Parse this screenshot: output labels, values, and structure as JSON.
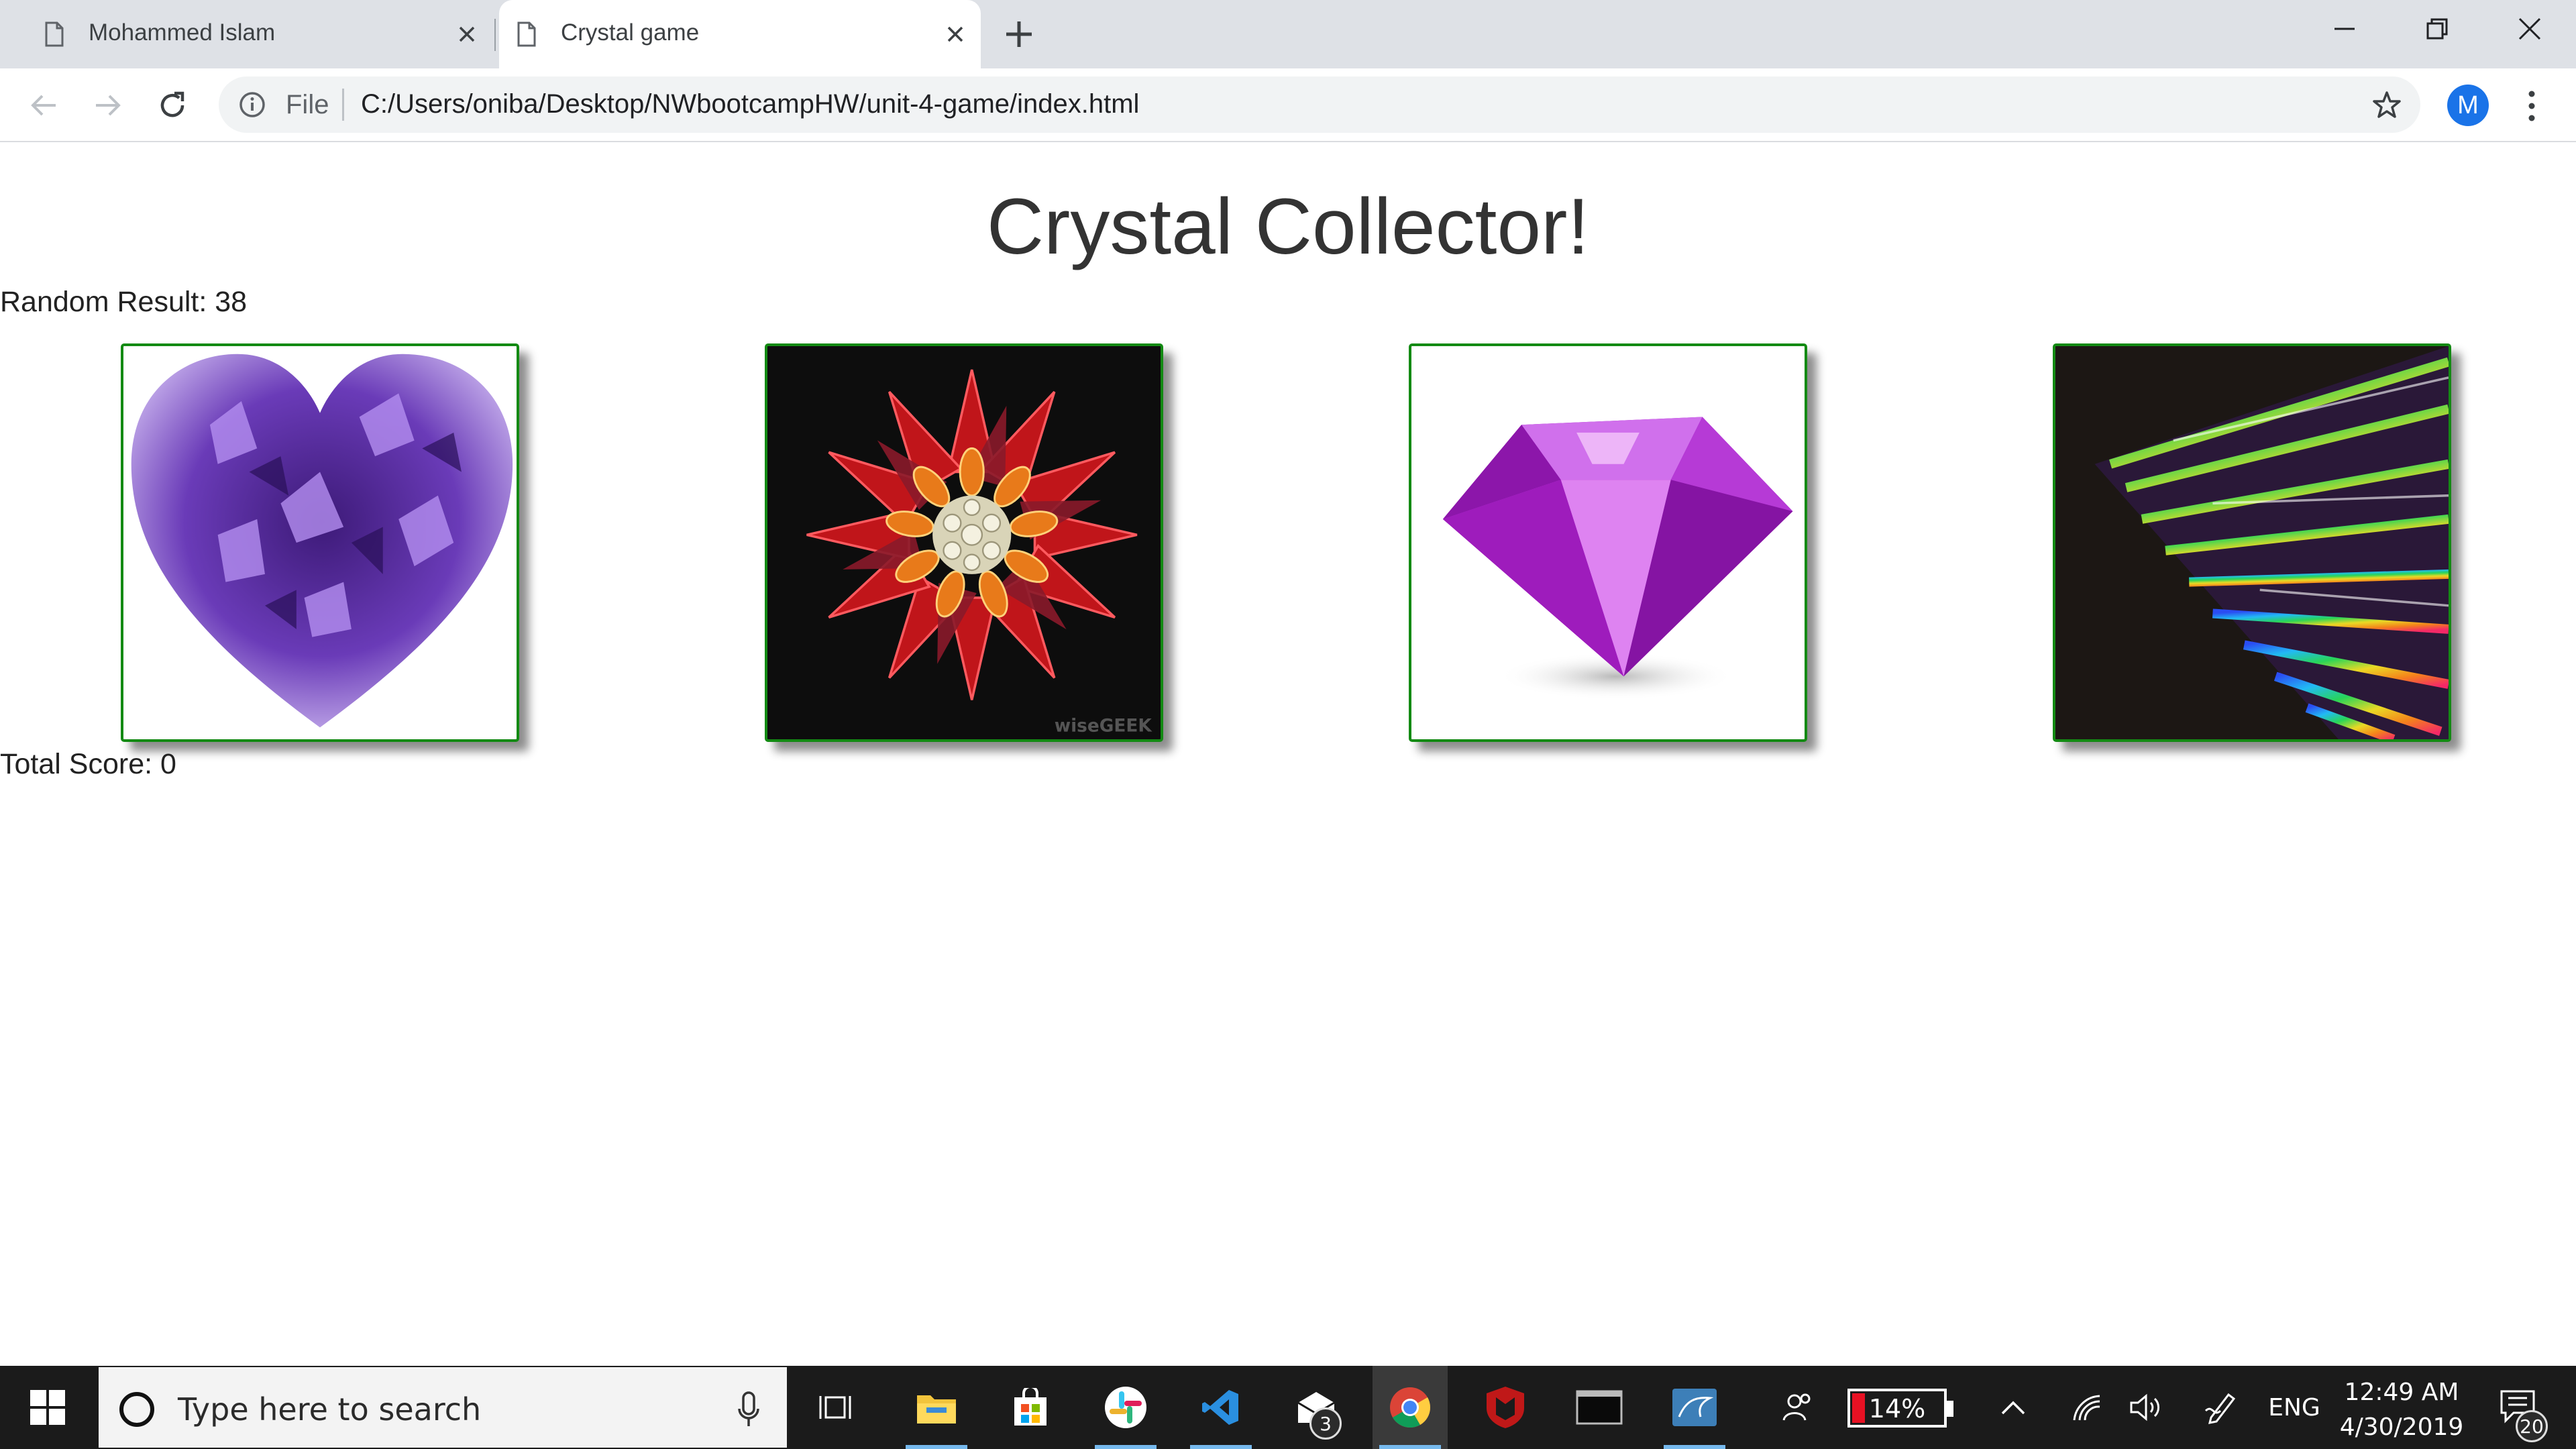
{
  "browser": {
    "tabs": [
      {
        "title": "Mohammed Islam",
        "active": false
      },
      {
        "title": "Crystal game",
        "active": true
      }
    ],
    "address": {
      "scheme": "File",
      "url": "C:/Users/oniba/Desktop/NWbootcampHW/unit-4-game/index.html"
    },
    "profile_initial": "M"
  },
  "page": {
    "title": "Crystal Collector!",
    "random_result": "Random Result: 38",
    "total_score": "Total Score: 0",
    "crystals": [
      {
        "name": "amethyst-heart",
        "border_color": "#138a13"
      },
      {
        "name": "red-flower-brooch",
        "border_color": "#138a13",
        "watermark": "wiseGEEK"
      },
      {
        "name": "purple-diamond",
        "border_color": "#138a13"
      },
      {
        "name": "rainbow-prism",
        "border_color": "#138a13"
      }
    ]
  },
  "taskbar": {
    "search_placeholder": "Type here to search",
    "apps": [
      "task-view",
      "file-explorer",
      "microsoft-store",
      "slack",
      "vs-code",
      "mail",
      "chrome",
      "mcafee",
      "terminal",
      "mysql-workbench"
    ],
    "mail_badge": "3",
    "battery_percent": "14%",
    "battery_level": 0.14,
    "language": "ENG",
    "time": "12:49 AM",
    "date": "4/30/2019",
    "notifications": "20"
  }
}
